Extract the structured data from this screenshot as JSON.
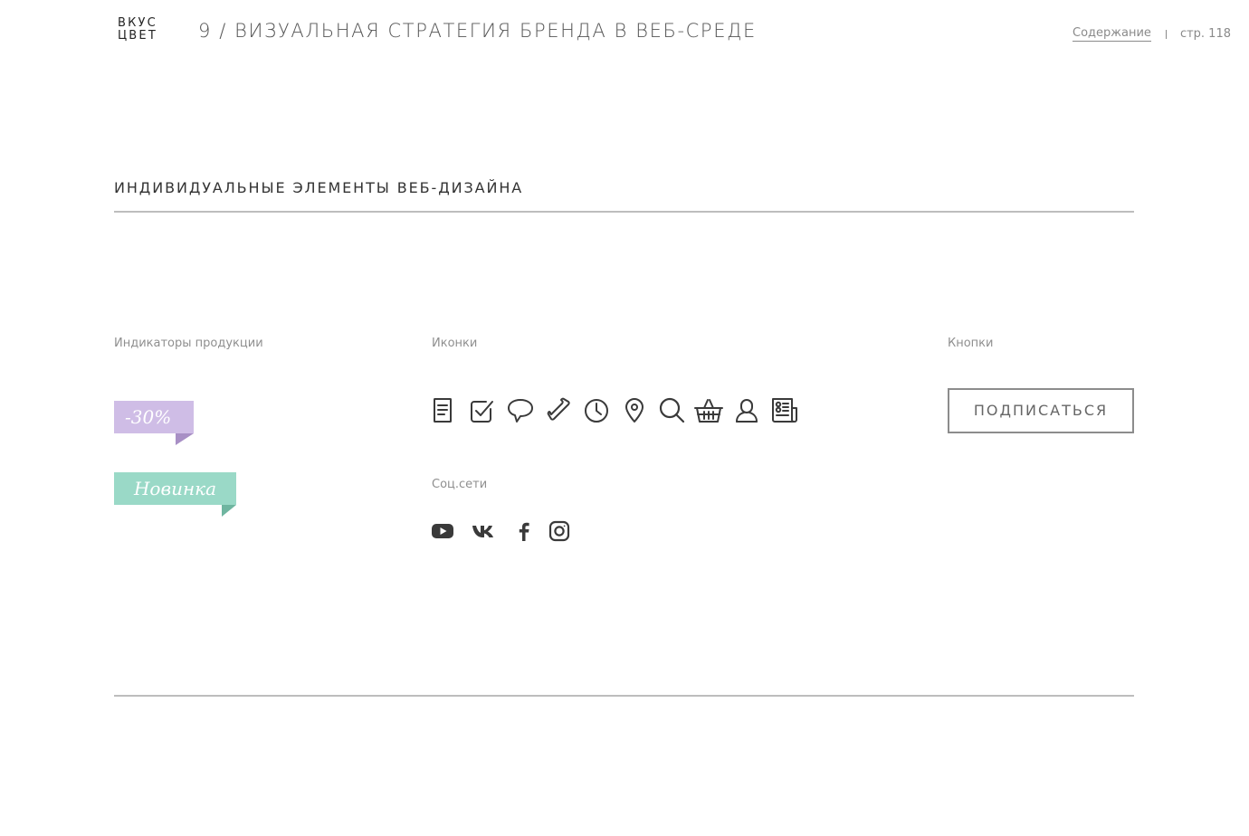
{
  "header": {
    "logo_line1": "ВКУС",
    "logo_line2": "ЦВЕТ",
    "chapter_title": "9 / ВИЗУАЛЬНАЯ СТРАТЕГИЯ БРЕНДА В ВЕБ-СРЕДЕ",
    "toc_link": "Содержание",
    "page_label": "стр. 118"
  },
  "section": {
    "title": "ИНДИВИДУАЛЬНЫЕ ЭЛЕМЕНТЫ ВЕБ-ДИЗАЙНА"
  },
  "indicators": {
    "label": "Индикаторы продукции",
    "discount": "-30%",
    "new": "Новинка",
    "discount_color": "#cfbde6",
    "new_color": "#9ad9c7"
  },
  "icons": {
    "label": "Иконки",
    "items": [
      "document-icon",
      "checkbox-icon",
      "chat-bubble-icon",
      "phone-icon",
      "clock-icon",
      "location-pin-icon",
      "search-icon",
      "basket-icon",
      "user-icon",
      "newspaper-icon"
    ]
  },
  "social": {
    "label": "Соц.сети",
    "items": [
      "youtube-icon",
      "vk-icon",
      "facebook-icon",
      "instagram-icon"
    ]
  },
  "buttons": {
    "label": "Кнопки",
    "subscribe": "ПОДПИСАТЬСЯ"
  },
  "colors": {
    "text": "#333333",
    "muted": "#8f8f8f",
    "rule": "#bdbdbd",
    "icon": "#3a3a3a"
  }
}
